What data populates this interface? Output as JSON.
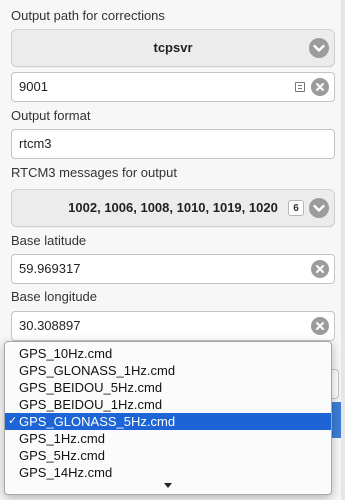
{
  "form": {
    "output_path_label": "Output path for corrections",
    "output_path_value": "tcpsvr",
    "port_value": "9001",
    "output_format_label": "Output format",
    "output_format_value": "rtcm3",
    "rtcm3_label": "RTCM3 messages for output",
    "rtcm3_value": "1002, 1006, 1008, 1010, 1019, 1020",
    "rtcm3_count": "6",
    "base_lat_label": "Base latitude",
    "base_lat_value": "59.969317",
    "base_lon_label": "Base longitude",
    "base_lon_value": "30.308897"
  },
  "dropdown": {
    "options": [
      "GPS_10Hz.cmd",
      "GPS_GLONASS_1Hz.cmd",
      "GPS_BEIDOU_5Hz.cmd",
      "GPS_BEIDOU_1Hz.cmd",
      "GPS_GLONASS_5Hz.cmd",
      "GPS_1Hz.cmd",
      "GPS_5Hz.cmd",
      "GPS_14Hz.cmd"
    ],
    "selected_index": 4,
    "check_glyph": "✓"
  },
  "icons": {
    "chevron": "chevron-down-icon",
    "clear": "clear-icon",
    "list": "list-icon",
    "scroll": "scroll-down-arrow"
  },
  "colors": {
    "selection": "#1d64d6",
    "icon_gray": "#9c9c9c",
    "accent_button": "#3a7fd5"
  }
}
